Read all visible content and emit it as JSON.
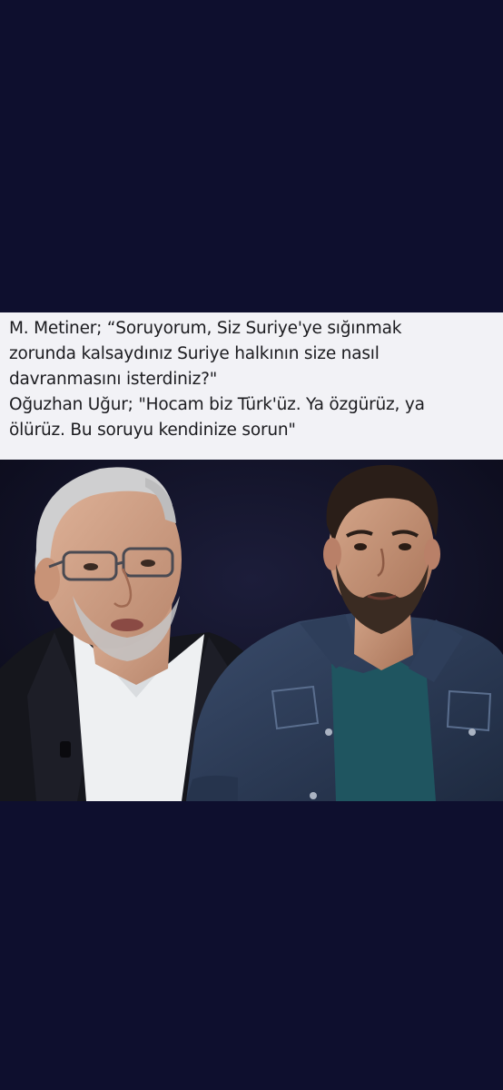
{
  "post": {
    "quote_lines": [
      "M. Metiner; “Soruyorum, Siz Suriye'ye sığınmak",
      "zorunda kalsaydınız Suriye halkının size nasıl",
      "davranmasını isterdiniz?\"",
      "Oğuzhan Uğur; \"Hocam biz Türk'üz. Ya özgürüz, ya",
      "ölürüz. Bu soruyu kendinize sorun\""
    ]
  },
  "photo": {
    "left_person": "older man with glasses in dark suit and white shirt",
    "right_person": "bearded man in denim jacket and teal t-shirt",
    "colors": {
      "background_navy": "#0e0f2e",
      "card_bg": "#f2f2f6",
      "suit": "#15161c",
      "denim": "#2c3b55",
      "tshirt": "#1f5560"
    }
  }
}
